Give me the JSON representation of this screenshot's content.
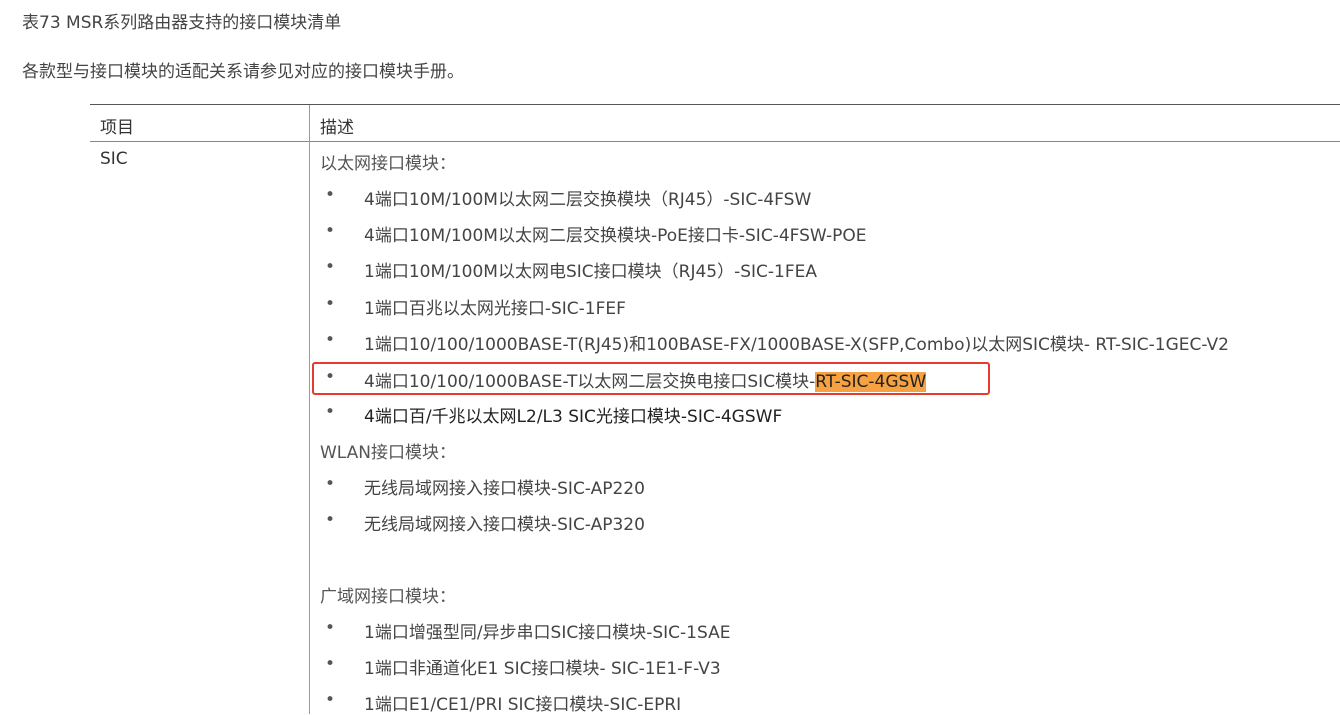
{
  "caption": "表73 MSR系列路由器支持的接口模块清单",
  "intro": "各款型与接口模块的适配关系请参见对应的接口模块手册。",
  "table": {
    "header": {
      "col1": "项目",
      "col2": "描述"
    },
    "row": {
      "item": "SIC",
      "sections": [
        {
          "title": "以太网接口模块：",
          "items": [
            "4端口10M/100M以太网二层交换模块（RJ45）-SIC-4FSW",
            "4端口10M/100M以太网二层交换模块-PoE接口卡-SIC-4FSW-POE",
            "1端口10M/100M以太网电SIC接口模块（RJ45）-SIC-1FEA",
            "1端口百兆以太网光接口-SIC-1FEF",
            "1端口10/100/1000BASE-T(RJ45)和100BASE-FX/1000BASE-X(SFP,Combo)以太网SIC模块- RT-SIC-1GEC-V2",
            "4端口10/100/1000BASE-T以太网二层交换电接口SIC模块-",
            "4端口百/千兆以太网L2/L3 SIC光接口模块-SIC-4GSWF"
          ],
          "highlight": "RT-SIC-4GSW"
        },
        {
          "title": "WLAN接口模块：",
          "items": [
            "无线局域网接入接口模块-SIC-AP220",
            "无线局域网接入接口模块-SIC-AP320"
          ]
        },
        {
          "title": "广域网接口模块：",
          "items": [
            "1端口增强型同/异步串口SIC接口模块-SIC-1SAE",
            "1端口非通道化E1 SIC接口模块- SIC-1E1-F-V3",
            "1端口E1/CE1/PRI SIC接口模块-SIC-EPRI"
          ]
        }
      ]
    }
  },
  "colors": {
    "highlight": "#f7a241",
    "annotation_box": "#e63b2e"
  }
}
